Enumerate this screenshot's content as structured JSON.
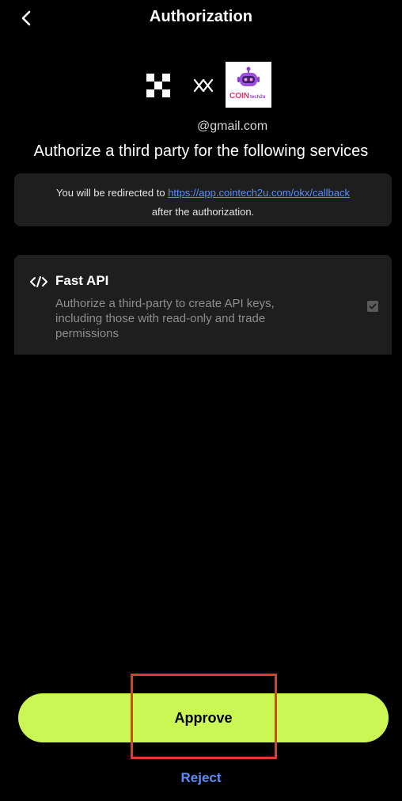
{
  "header": {
    "title": "Authorization"
  },
  "account": {
    "email": "@gmail.com"
  },
  "app_logo": {
    "text_coin": "COIN",
    "text_tech": "tech2u"
  },
  "headline": "Authorize a third party for the following services",
  "redirect": {
    "prefix": "You will be redirected to ",
    "url": "https://app.cointech2u.com/okx/callback",
    "suffix": "after the authorization."
  },
  "service": {
    "name": "Fast API",
    "description": "Authorize a third-party to create API keys, including those with read-only and trade permissions",
    "checked": true
  },
  "actions": {
    "approve_label": "Approve",
    "reject_label": "Reject"
  },
  "colors": {
    "approve_bg": "#caf753",
    "link": "#5a8dff",
    "highlight": "#e63a2a",
    "card_bg": "#1e1e1e"
  },
  "icons": {
    "back": "chevron-left-icon",
    "okx": "okx-logo",
    "link": "link-connect-icon",
    "service": "code-icon",
    "check": "check-icon"
  }
}
